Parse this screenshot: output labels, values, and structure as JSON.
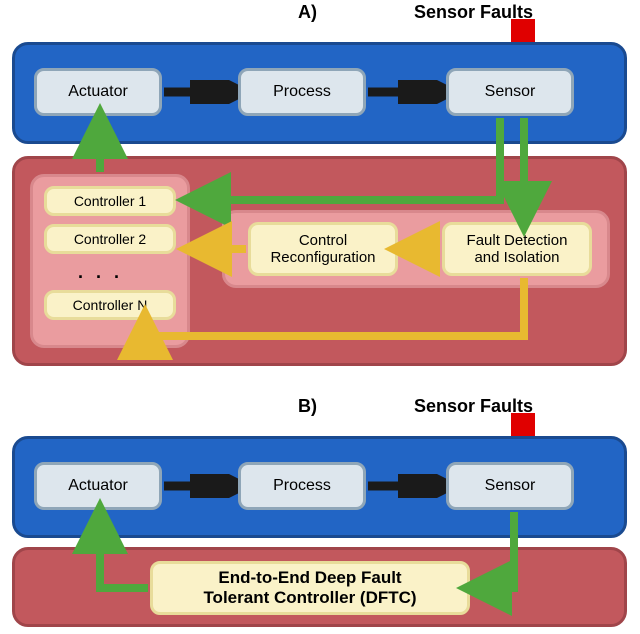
{
  "labels": {
    "A": "A)",
    "B": "B)",
    "sensor_faults": "Sensor Faults"
  },
  "plant": {
    "actuator": "Actuator",
    "process": "Process",
    "sensor": "Sensor"
  },
  "ftc_a": {
    "controllers": {
      "c1": "Controller 1",
      "c2": "Controller 2",
      "dots": ". . .",
      "cN": "Controller N"
    },
    "reconfig": "Control\nReconfiguration",
    "fdi": "Fault Detection\nand Isolation"
  },
  "ftc_b": {
    "dftc": "End-to-End Deep Fault\nTolerant Controller (DFTC)"
  },
  "colors": {
    "blue": "#2265c5",
    "red": "#c2585d",
    "box": "#dde6ed",
    "yellow": "#faf2c8",
    "arrow_black": "#1a1a1a",
    "arrow_green": "#4fa83d",
    "arrow_yellow": "#e8b930",
    "arrow_red": "#e00000"
  }
}
